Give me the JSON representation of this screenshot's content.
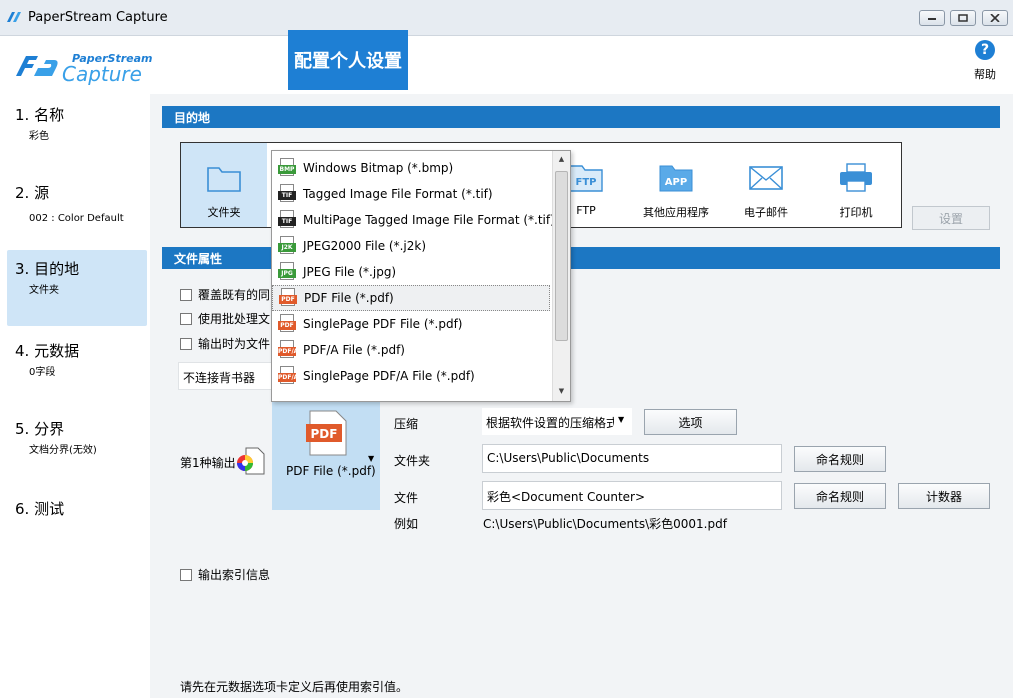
{
  "window": {
    "title": "PaperStream Capture"
  },
  "logo": {
    "line1": "PaperStream",
    "line2": "Capture"
  },
  "header": {
    "tab_label": "配置个人设置",
    "help_label": "帮助"
  },
  "nav": [
    {
      "name": "1. 名称",
      "sub": "彩色"
    },
    {
      "name": "2. 源",
      "sub": "002 : Color Default"
    },
    {
      "name": "3. 目的地",
      "sub": "文件夹"
    },
    {
      "name": "4. 元数据",
      "sub": "0字段"
    },
    {
      "name": "5. 分界",
      "sub": "文档分界(无效)"
    },
    {
      "name": "6. 测试",
      "sub": ""
    }
  ],
  "destination": {
    "section_title": "目的地",
    "items": [
      {
        "label": "文件夹",
        "icon": "folder-icon"
      },
      {
        "label": "FTP",
        "icon": "ftp-icon"
      },
      {
        "label": "其他应用程序",
        "icon": "app-icon"
      },
      {
        "label": "电子邮件",
        "icon": "email-icon"
      },
      {
        "label": "打印机",
        "icon": "printer-icon"
      }
    ],
    "ftp_badge": "FTP",
    "app_badge": "APP",
    "settings_button": "设置"
  },
  "file_props": {
    "section_title": "文件属性",
    "checkbox1": "覆盖既有的同",
    "checkbox2": "使用批处理文",
    "checkbox3": "输出时为文件",
    "endorser": "不连接背书器",
    "output_label": "第1种输出",
    "format_label": "PDF File (*.pdf)",
    "format_badge": "PDF",
    "compression_label": "压缩",
    "compression_value": "根据软件设置的压缩格式",
    "options_button": "选项",
    "folder_label": "文件夹",
    "folder_value": "C:\\Users\\Public\\Documents",
    "naming_button": "命名规则",
    "file_label": "文件",
    "file_value": "彩色<Document Counter>",
    "naming_button2": "命名规则",
    "counter_button": "计数器",
    "example_label": "例如",
    "example_value": "C:\\Users\\Public\\Documents\\彩色0001.pdf",
    "index_checkbox": "输出索引信息",
    "note": "请先在元数据选项卡定义后再使用索引值。"
  },
  "dropdown": {
    "items": [
      {
        "label": "Windows Bitmap (*.bmp)",
        "tag": "BMP",
        "color": "#3a9a3a"
      },
      {
        "label": "Tagged Image File Format (*.tif)",
        "tag": "TIF",
        "color": "#222222"
      },
      {
        "label": "MultiPage Tagged Image File Format (*.tif)",
        "tag": "TIF",
        "color": "#222222"
      },
      {
        "label": "JPEG2000 File (*.j2k)",
        "tag": "J2K",
        "color": "#3a9a3a"
      },
      {
        "label": "JPEG File (*.jpg)",
        "tag": "JPG",
        "color": "#3a9a3a"
      },
      {
        "label": "PDF File (*.pdf)",
        "tag": "PDF",
        "color": "#e05a2b"
      },
      {
        "label": "SinglePage PDF File (*.pdf)",
        "tag": "PDF",
        "color": "#e05a2b"
      },
      {
        "label": "PDF/A File (*.pdf)",
        "tag": "PDF/A",
        "color": "#e05a2b"
      },
      {
        "label": "SinglePage PDF/A File (*.pdf)",
        "tag": "PDF/A",
        "color": "#e05a2b"
      }
    ],
    "hovered_index": 5
  },
  "colors": {
    "accent": "#1e7fd4",
    "section": "#1c77c3",
    "selected": "#cfe5f7"
  }
}
